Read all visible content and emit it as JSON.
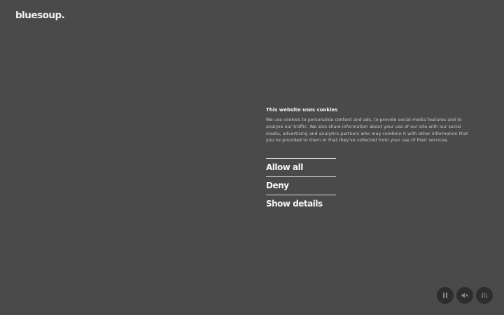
{
  "brand": {
    "logo_text": "bluesoup."
  },
  "cookie_banner": {
    "title": "This website uses cookies",
    "body": "We use cookies to personalise content and ads, to provide social media features and to analyse our traffic. We also share information about your use of our site with our social media, advertising and analytics partners who may combine it with other information that you've provided to them or that they've collected from your use of their services.",
    "actions": [
      {
        "label": "Allow all"
      },
      {
        "label": "Deny"
      },
      {
        "label": "Show details"
      }
    ]
  },
  "media_controls": {
    "icons": [
      "pause-icon",
      "mute-icon",
      "equalizer-icon"
    ]
  },
  "colors": {
    "background": "#4a4a4a",
    "control_bg": "#2d2d2d",
    "text": "#f5f5f5"
  }
}
